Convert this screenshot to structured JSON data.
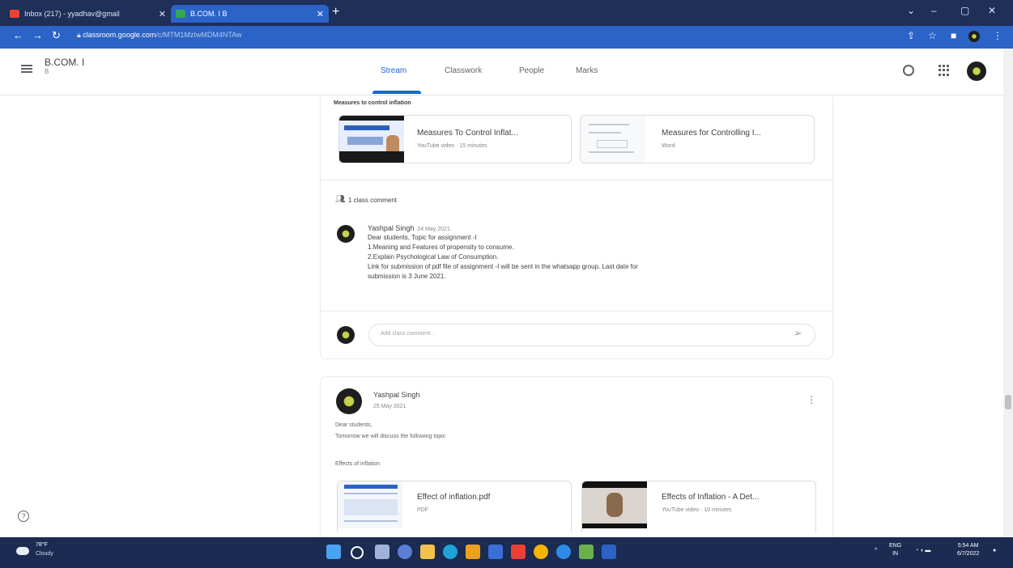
{
  "browser": {
    "tabs": [
      {
        "label": "Inbox (217) - yyadhav@gmail",
        "active": false
      },
      {
        "label": "B.COM. I B",
        "active": true
      }
    ],
    "url_host": "classroom.google.com",
    "url_path": "/c/MTM1MzIwMDM4NTAw"
  },
  "header": {
    "class_name": "B.COM. I",
    "class_section": "B",
    "tabs": [
      "Stream",
      "Classwork",
      "People",
      "Marks"
    ],
    "active_tab": "Stream"
  },
  "post1": {
    "title": "Measures to control inflation",
    "attachments": [
      {
        "title": "Measures To Control Inflat...",
        "subtitle": "YouTube video · 15 minutes"
      },
      {
        "title": "Measures for Controlling I...",
        "subtitle": "Word"
      }
    ],
    "comment_count": "1 class comment",
    "comment": {
      "author": "Yashpal Singh",
      "date": "24 May 2021",
      "lines": [
        "Dear students, Topic for assignment -I",
        "1.Meaning and Features of propensity to consume.",
        "2.Explain Psychological Law of Consumption.",
        "Link for submission of pdf file of assignment -I will be sent in the whatsapp group. Last date for",
        "submission is 3 June 2021."
      ]
    },
    "comment_placeholder": "Add class comment..."
  },
  "post2": {
    "author": "Yashpal Singh",
    "date": "25 May 2021",
    "lines": [
      "Dear students,",
      "Tomorrow we will discuss the following topic"
    ],
    "topic": "Effects of inflation",
    "attachments": [
      {
        "title": "Effect of inflation.pdf",
        "subtitle": "PDF"
      },
      {
        "title": "Effects of Inflation - A Det...",
        "subtitle": "YouTube video · 10 minutes"
      }
    ]
  },
  "taskbar": {
    "temperature": "78°F",
    "condition": "Cloudy",
    "language": "ENG",
    "region": "IN",
    "time": "5:54 AM",
    "date": "6/7/2022"
  },
  "colors": {
    "accent": "#1967d2",
    "chrome_dark": "#1e2f58",
    "chrome_blue": "#2b63c6",
    "taskbar": "#1b2b52"
  }
}
